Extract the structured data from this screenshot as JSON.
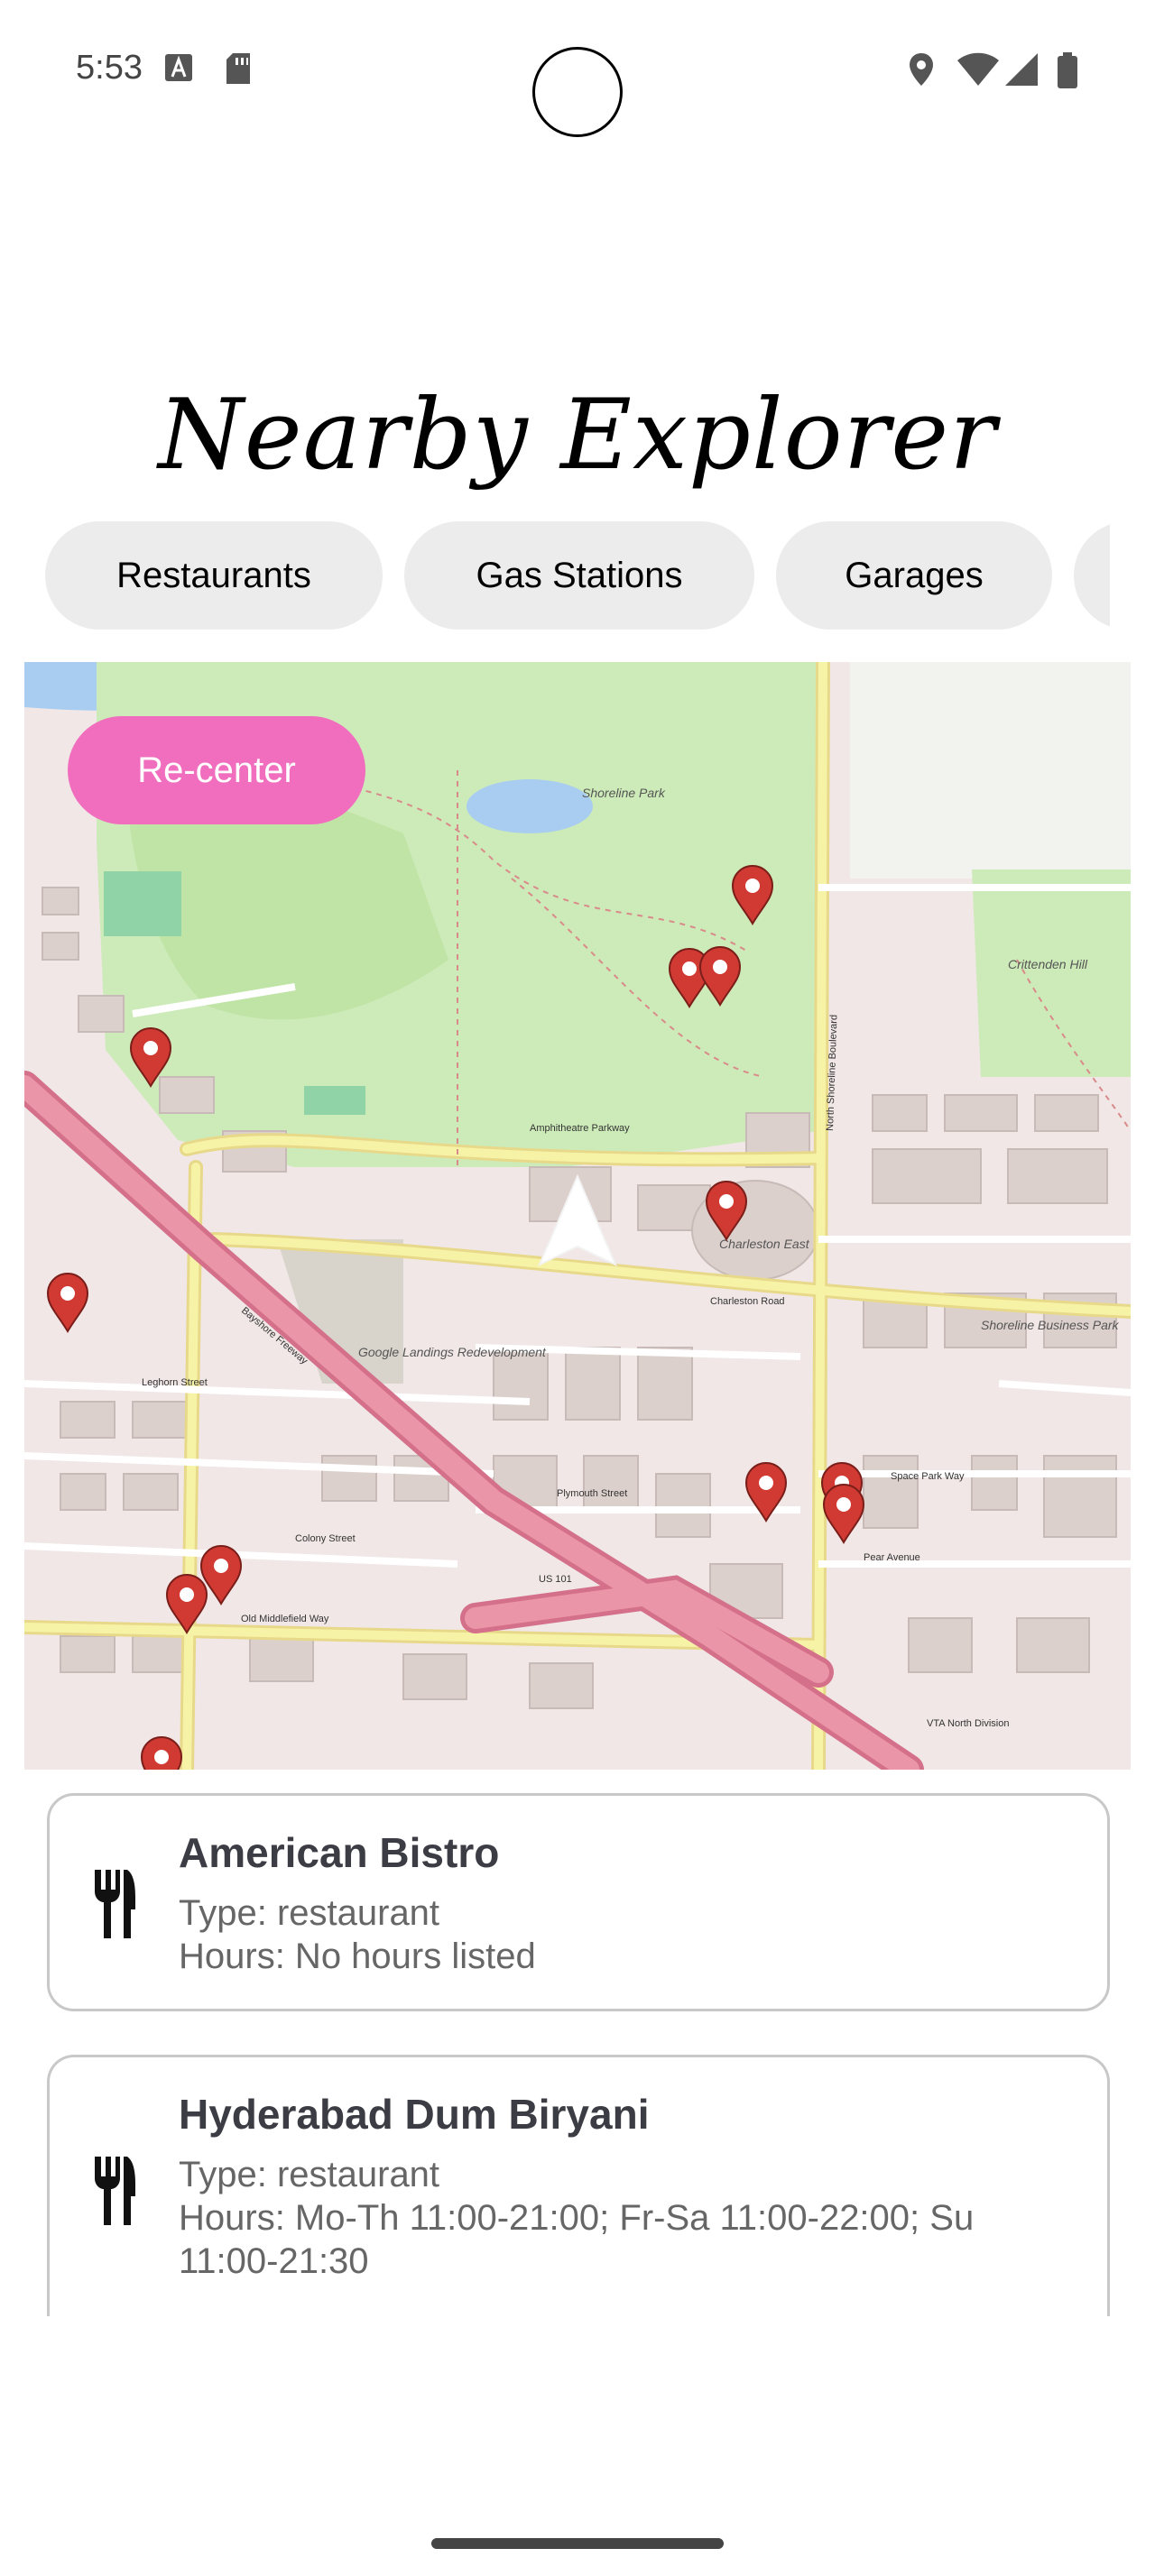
{
  "status_bar": {
    "time": "5:53",
    "icons": [
      "text-a-icon",
      "sd-card-icon",
      "location-icon",
      "wifi-icon",
      "signal-icon",
      "battery-icon"
    ]
  },
  "app": {
    "title": "Nearby Explorer"
  },
  "chips": [
    {
      "label": "Restaurants"
    },
    {
      "label": "Gas Stations"
    },
    {
      "label": "Garages"
    },
    {
      "label": ""
    }
  ],
  "map": {
    "recenter_label": "Re-center",
    "labels": {
      "shoreline_park": "Shoreline Park",
      "charleston_east": "Charleston East",
      "shoreline_business_park": "Shoreline Business Park",
      "crittenden_hill": "Crittenden Hill",
      "google_landings": "Google Landings Redevelopment",
      "amphitheatre_parkway": "Amphitheatre Parkway",
      "charleston_road": "Charleston Road",
      "north_shoreline_blvd": "North Shoreline Boulevard",
      "bayshore_freeway": "Bayshore Freeway",
      "old_middlefield_way": "Old Middlefield Way",
      "us101": "US 101",
      "vta_north_division": "VTA North Division",
      "plymouth_street": "Plymouth Street",
      "pear_avenue": "Pear Avenue",
      "space_park_way": "Space Park Way",
      "colony_street": "Colony Street",
      "leghorn_street": "Leghorn Street"
    },
    "marker_count": 14
  },
  "places": [
    {
      "icon": "fork-knife-icon",
      "name": "American Bistro",
      "type": "Type: restaurant",
      "hours": "Hours: No hours listed",
      "hours_cont": ""
    },
    {
      "icon": "fork-knife-icon",
      "name": "Hyderabad Dum Biryani",
      "type": "Type: restaurant",
      "hours": "Hours: Mo-Th 11:00-21:00; Fr-Sa 11:00-22:00; Su",
      "hours_cont": "11:00-21:30"
    }
  ],
  "colors": {
    "accent": "#f06ebd",
    "chip_bg": "#ececec",
    "marker": "#d13a33",
    "park": "#c9ecb4",
    "major_road": "#e8829a",
    "secondary_road": "#f6f3a7"
  }
}
